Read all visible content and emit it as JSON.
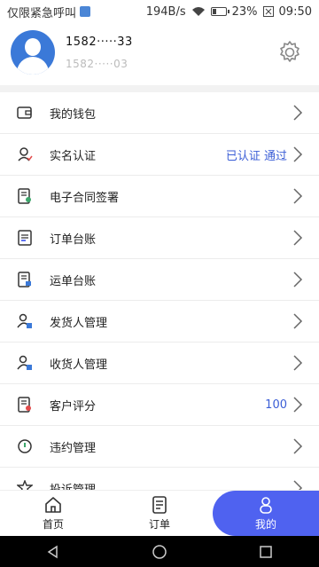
{
  "status_bar": {
    "carrier": "仅限紧急呼叫",
    "speed": "194B/s",
    "battery": "23%",
    "time": "09:50"
  },
  "profile": {
    "phone_main": "1582·····33",
    "phone_sub": "1582·····03"
  },
  "menu": {
    "items": [
      {
        "label": "我的钱包",
        "value": "",
        "icon": "wallet-icon"
      },
      {
        "label": "实名认证",
        "value": "已认证 通过",
        "icon": "user-verify-icon"
      },
      {
        "label": "电子合同签署",
        "value": "",
        "icon": "contract-icon"
      },
      {
        "label": "订单台账",
        "value": "",
        "icon": "order-ledger-icon"
      },
      {
        "label": "运单台账",
        "value": "",
        "icon": "waybill-ledger-icon"
      },
      {
        "label": "发货人管理",
        "value": "",
        "icon": "shipper-icon"
      },
      {
        "label": "收货人管理",
        "value": "",
        "icon": "consignee-icon"
      },
      {
        "label": "客户评分",
        "value": "100",
        "icon": "rating-icon"
      },
      {
        "label": "违约管理",
        "value": "",
        "icon": "breach-icon"
      },
      {
        "label": "投诉管理",
        "value": "",
        "icon": "complaint-icon"
      }
    ]
  },
  "tabbar": {
    "tabs": [
      {
        "label": "首页",
        "icon": "home-icon"
      },
      {
        "label": "订单",
        "icon": "order-icon"
      },
      {
        "label": "我的",
        "icon": "profile-icon"
      }
    ]
  },
  "colors": {
    "accent": "#4f62f0",
    "value_text": "#3b5ed6"
  }
}
